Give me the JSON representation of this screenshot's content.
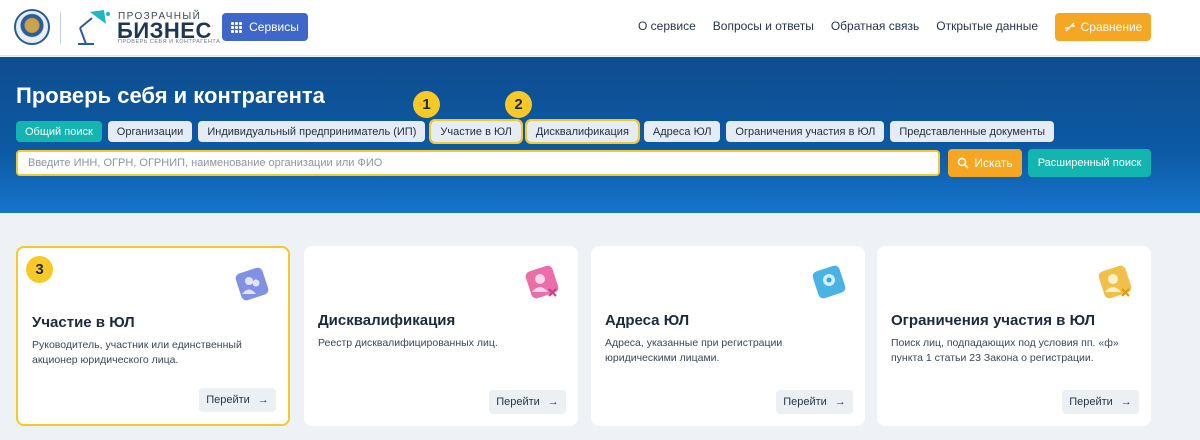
{
  "header": {
    "logo_top": "ПРОЗРАЧНЫЙ",
    "logo_main": "БИЗНЕС",
    "logo_sub": "ПРОВЕРЬ СЕБЯ И КОНТРАГЕНТА",
    "services_label": "Сервисы",
    "nav": [
      "О сервисе",
      "Вопросы и ответы",
      "Обратная связь",
      "Открытые данные"
    ],
    "compare_label": "Сравнение"
  },
  "hero": {
    "title": "Проверь себя и контрагента",
    "tabs": [
      {
        "label": "Общий поиск",
        "active": true
      },
      {
        "label": "Организации"
      },
      {
        "label": "Индивидуальный предприниматель (ИП)"
      },
      {
        "label": "Участие в ЮЛ"
      },
      {
        "label": "Дисквалификация"
      },
      {
        "label": "Адреса ЮЛ"
      },
      {
        "label": "Ограничения участия в ЮЛ"
      },
      {
        "label": "Представленные документы"
      }
    ],
    "search_placeholder": "Введите ИНН, ОГРН, ОГРНИП, наименование организации или ФИО",
    "search_button": "Искать",
    "advanced_button": "Расширенный поиск"
  },
  "badges": [
    "1",
    "2",
    "3"
  ],
  "cards": [
    {
      "title": "Участие в ЮЛ",
      "desc": "Руководитель, участник или единственный акционер юридического лица.",
      "button": "Перейти",
      "icon": "users-icon",
      "color": "#6b7fe0"
    },
    {
      "title": "Дисквалификация",
      "desc": "Реестр дисквалифицированных лиц.",
      "button": "Перейти",
      "icon": "user-block-icon",
      "color": "#e8559a"
    },
    {
      "title": "Адреса ЮЛ",
      "desc": "Адреса, указанные при регистрации юридическими лицами.",
      "button": "Перейти",
      "icon": "location-icon",
      "color": "#2aa6e0"
    },
    {
      "title": "Ограничения участия в ЮЛ",
      "desc": "Поиск лиц, подпадающих под условия пп. «ф» пункта 1 статьи 23 Закона о регистрации.",
      "button": "Перейти",
      "icon": "user-restrict-icon",
      "color": "#f0b429"
    }
  ],
  "colors": {
    "accent": "#3f67c9",
    "orange": "#f5a623",
    "teal": "#12b5b0",
    "highlight": "#f7c928",
    "hero": "#0c5aa4"
  }
}
